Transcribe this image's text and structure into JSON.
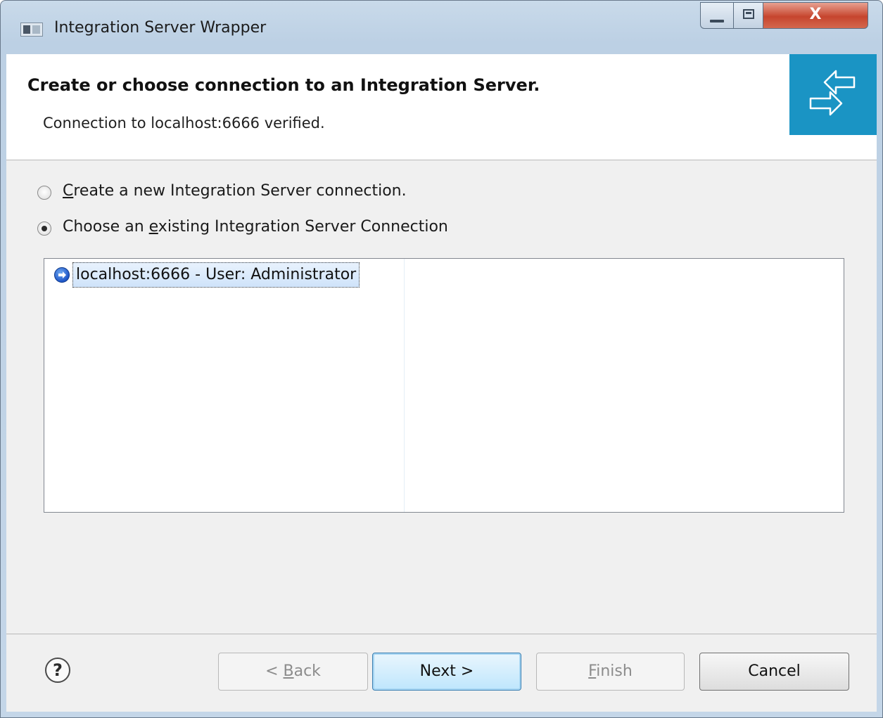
{
  "window": {
    "title": "Integration Server Wrapper",
    "close_glyph": "X"
  },
  "header": {
    "title": "Create or choose connection to an Integration Server.",
    "message": "Connection to localhost:6666 verified.",
    "banner_color": "#1a94c4"
  },
  "options": {
    "create_new": {
      "prefix": "",
      "mnemonic": "C",
      "rest": "reate a new Integration Server connection.",
      "checked": false
    },
    "choose_existing": {
      "prefix": "Choose an ",
      "mnemonic": "e",
      "rest": "xisting Integration Server Connection",
      "checked": true
    }
  },
  "connections": [
    {
      "label": "localhost:6666 - User: Administrator",
      "selected": true
    }
  ],
  "buttons": {
    "help": "?",
    "back": {
      "prefix": "< ",
      "mnemonic": "B",
      "rest": "ack",
      "enabled": false
    },
    "next": {
      "label": "Next >",
      "enabled": true
    },
    "finish": {
      "prefix": "",
      "mnemonic": "F",
      "rest": "inish",
      "enabled": false
    },
    "cancel": {
      "label": "Cancel",
      "enabled": true
    }
  },
  "icons": {
    "app": "app-window-icon",
    "banner": "connection-arrows-icon",
    "connection": "server-connection-icon",
    "help": "help-icon"
  }
}
